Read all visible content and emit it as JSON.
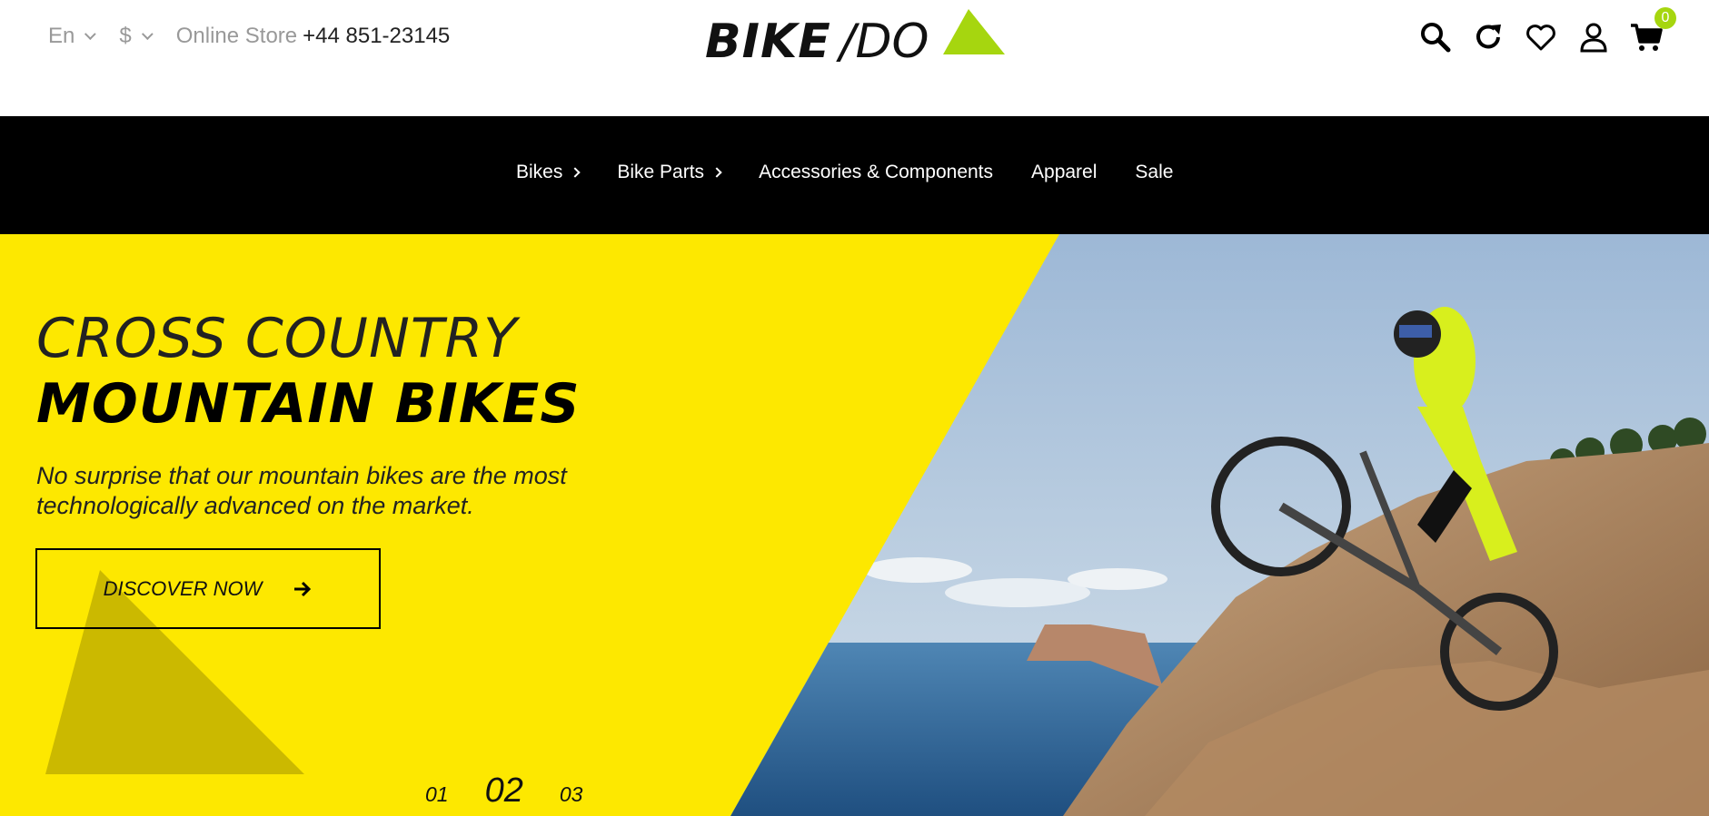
{
  "header": {
    "language": "En",
    "currency": "$",
    "store_label": "Online Store",
    "phone": "+44 851-23145",
    "logo_part1": "BIKE",
    "logo_part2": "/DO",
    "cart_count": "0",
    "icons": [
      "search-icon",
      "refresh-icon",
      "heart-icon",
      "user-icon",
      "cart-icon"
    ]
  },
  "nav": {
    "items": [
      {
        "label": "Bikes",
        "has_submenu": true
      },
      {
        "label": "Bike Parts",
        "has_submenu": true
      },
      {
        "label": "Accessories & Components",
        "has_submenu": false
      },
      {
        "label": "Apparel",
        "has_submenu": false
      },
      {
        "label": "Sale",
        "has_submenu": false
      }
    ]
  },
  "hero": {
    "title_line1": "CROSS COUNTRY",
    "title_line2": "MOUNTAIN BIKES",
    "description": "No surprise that our mountain bikes are the most technologically advanced on the market.",
    "cta_label": "DISCOVER NOW",
    "slides": [
      "01",
      "02",
      "03"
    ],
    "active_slide": 1
  },
  "colors": {
    "accent_yellow": "#fde800",
    "brand_green": "#a6d60f",
    "nav_bg": "#000000"
  }
}
